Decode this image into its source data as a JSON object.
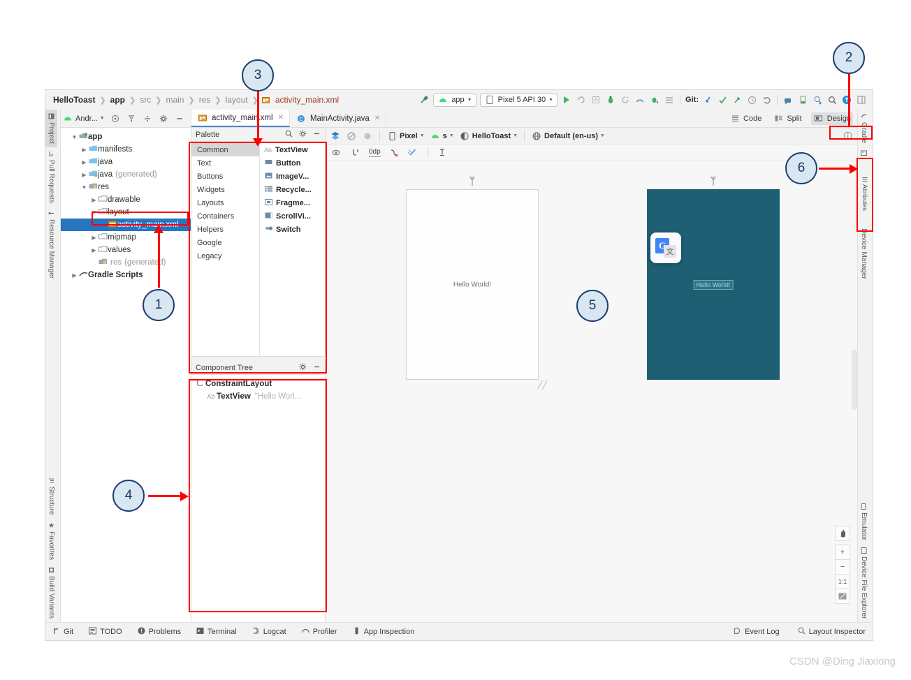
{
  "window": {
    "breadcrumb": [
      "HelloToast",
      "app",
      "src",
      "main",
      "res",
      "layout",
      "activity_main.xml"
    ],
    "run_config": "app",
    "device_target": "Pixel 5 API 30",
    "git_label": "Git:"
  },
  "project_toolbar": {
    "title": "Andr...",
    "icons": [
      "target-icon",
      "collapse-all-icon",
      "split-icon",
      "settings-icon",
      "minimize-icon"
    ]
  },
  "editor_tabs": [
    {
      "label": "activity_main.xml",
      "icon": "xml-layout-icon",
      "active": true,
      "closable": true
    },
    {
      "label": "MainActivity.java",
      "icon": "java-class-icon",
      "active": false,
      "closable": true
    }
  ],
  "view_modes": [
    {
      "label": "Code",
      "icon": "code-icon",
      "selected": false
    },
    {
      "label": "Split",
      "icon": "split-icon",
      "selected": false
    },
    {
      "label": "Design",
      "icon": "design-icon",
      "selected": true
    }
  ],
  "left_rail": {
    "top": [
      {
        "label": "Project",
        "icon": "project-icon",
        "selected": true
      },
      {
        "label": "Pull Requests",
        "icon": "pull-request-icon",
        "selected": false
      },
      {
        "label": "Resource Manager",
        "icon": "resource-icon",
        "selected": false
      }
    ],
    "bottom": [
      {
        "label": "Structure",
        "icon": "structure-icon"
      },
      {
        "label": "Favorites",
        "icon": "star-icon"
      },
      {
        "label": "Build Variants",
        "icon": "build-variants-icon"
      }
    ]
  },
  "right_rail": {
    "top": [
      {
        "label": "Gradle",
        "icon": "gradle-icon"
      },
      {
        "label": "Layout Validation",
        "icon": "layout-validation-icon"
      },
      {
        "label": "Device Manager",
        "icon": "device-manager-icon"
      }
    ],
    "bottom": [
      {
        "label": "Emulator",
        "icon": "emulator-icon"
      },
      {
        "label": "Device File Explorer",
        "icon": "device-file-explorer-icon"
      }
    ],
    "attributes_tab": {
      "label": "Attributes",
      "icon": "attributes-icon"
    }
  },
  "project_tree": [
    {
      "label": "app",
      "indent": 0,
      "arrow": "expanded",
      "icon": "module-icon",
      "bold": true,
      "dim": "",
      "selected": false
    },
    {
      "label": "manifests",
      "indent": 1,
      "arrow": "collapsed",
      "icon": "folder-blue-icon",
      "bold": false,
      "dim": "",
      "selected": false
    },
    {
      "label": "java",
      "indent": 1,
      "arrow": "collapsed",
      "icon": "folder-blue-icon",
      "bold": false,
      "dim": "",
      "selected": false
    },
    {
      "label": "java",
      "indent": 1,
      "arrow": "collapsed",
      "icon": "folder-blue-icon",
      "bold": false,
      "dim": "(generated)",
      "selected": false
    },
    {
      "label": "res",
      "indent": 1,
      "arrow": "expanded",
      "icon": "folder-res-icon",
      "bold": false,
      "dim": "",
      "selected": false
    },
    {
      "label": "drawable",
      "indent": 2,
      "arrow": "collapsed",
      "icon": "folder-gray-icon",
      "bold": false,
      "dim": "",
      "selected": false
    },
    {
      "label": "layout",
      "indent": 2,
      "arrow": "expanded",
      "icon": "folder-gray-icon",
      "bold": false,
      "dim": "",
      "selected": false
    },
    {
      "label": "activity_main.xml",
      "indent": 3,
      "arrow": "none",
      "icon": "xml-layout-icon",
      "bold": false,
      "dim": "",
      "selected": true
    },
    {
      "label": "mipmap",
      "indent": 2,
      "arrow": "collapsed",
      "icon": "folder-gray-icon",
      "bold": false,
      "dim": "",
      "selected": false
    },
    {
      "label": "values",
      "indent": 2,
      "arrow": "collapsed",
      "icon": "folder-gray-icon",
      "bold": false,
      "dim": "",
      "selected": false
    },
    {
      "label": "res",
      "indent": 2,
      "arrow": "none",
      "icon": "folder-res-icon",
      "bold": false,
      "dim": "(generated)",
      "selected": false
    },
    {
      "label": "Gradle Scripts",
      "indent": 0,
      "arrow": "collapsed",
      "icon": "gradle-icon",
      "bold": true,
      "dim": "",
      "selected": false
    }
  ],
  "palette": {
    "title": "Palette",
    "tools": [
      "search-icon",
      "gear-icon",
      "minimize-icon"
    ],
    "categories": [
      {
        "label": "Common",
        "selected": true
      },
      {
        "label": "Text",
        "selected": false
      },
      {
        "label": "Buttons",
        "selected": false
      },
      {
        "label": "Widgets",
        "selected": false
      },
      {
        "label": "Layouts",
        "selected": false
      },
      {
        "label": "Containers",
        "selected": false
      },
      {
        "label": "Helpers",
        "selected": false
      },
      {
        "label": "Google",
        "selected": false
      },
      {
        "label": "Legacy",
        "selected": false
      }
    ],
    "items": [
      {
        "label": "TextView",
        "icon": "ab-text-icon"
      },
      {
        "label": "Button",
        "icon": "button-icon"
      },
      {
        "label": "ImageV...",
        "icon": "image-view-icon"
      },
      {
        "label": "Recycle...",
        "icon": "recycler-view-icon"
      },
      {
        "label": "Fragme...",
        "icon": "fragment-icon"
      },
      {
        "label": "ScrollVi...",
        "icon": "scroll-view-icon"
      },
      {
        "label": "Switch",
        "icon": "switch-icon"
      }
    ]
  },
  "component_tree": {
    "title": "Component Tree",
    "tools": [
      "gear-icon",
      "minimize-icon"
    ],
    "nodes": [
      {
        "icon": "constraint-layout-icon",
        "name": "ConstraintLayout",
        "value": "",
        "indent": 0
      },
      {
        "icon": "ab-text-icon",
        "name": "TextView",
        "value": "\"Hello Worl...",
        "indent": 1
      }
    ]
  },
  "design_toolbar": {
    "row1": {
      "mode_icons": [
        "design-surface-icon",
        "blueprint-icon",
        "both-modes-icon"
      ],
      "menus": [
        {
          "label": "Pixel",
          "icon": "device-icon"
        },
        {
          "label": "s",
          "icon": "api-icon"
        },
        {
          "label": "HelloToast",
          "icon": "theme-icon"
        },
        {
          "label": "Default (en-us)",
          "icon": "locale-icon"
        }
      ]
    },
    "row2": {
      "icons": [
        "view-options-icon",
        "autoconnect-icon",
        "default-margin-0dp",
        "clear-constraints-icon",
        "infer-constraints-icon",
        "baseline-align-icon"
      ],
      "margin_value": "0dp"
    },
    "info_icon": "info-icon"
  },
  "canvas": {
    "devices": [
      {
        "name": "design-preview",
        "label_icon": "pin-icon",
        "text": "Hello World!"
      },
      {
        "name": "blueprint-preview",
        "label_icon": "pin-icon",
        "text": "Hello World!"
      }
    ],
    "zoom_controls": [
      {
        "label": "✋",
        "name": "pan-tool-button"
      },
      {
        "label": "+",
        "name": "zoom-in-button"
      },
      {
        "label": "−",
        "name": "zoom-out-button"
      },
      {
        "label": "1:1",
        "name": "zoom-actual-button"
      },
      {
        "label": "⛶",
        "name": "zoom-fit-button"
      }
    ],
    "overlay_icon": {
      "name": "google-translate-icon",
      "letter": "G",
      "glyph": "文"
    }
  },
  "status_bar": {
    "left": [
      {
        "label": "Git",
        "icon": "git-branch-icon"
      },
      {
        "label": "TODO",
        "icon": "todo-icon"
      },
      {
        "label": "Problems",
        "icon": "problems-icon"
      },
      {
        "label": "Terminal",
        "icon": "terminal-icon"
      },
      {
        "label": "Logcat",
        "icon": "logcat-icon"
      },
      {
        "label": "Profiler",
        "icon": "profiler-icon"
      },
      {
        "label": "App Inspection",
        "icon": "app-inspection-icon"
      }
    ],
    "right": [
      {
        "label": "Event Log",
        "icon": "event-log-icon"
      },
      {
        "label": "Layout Inspector",
        "icon": "layout-inspector-icon"
      }
    ]
  },
  "annotations": {
    "callouts": [
      {
        "number": "1"
      },
      {
        "number": "2"
      },
      {
        "number": "3"
      },
      {
        "number": "4"
      },
      {
        "number": "5"
      },
      {
        "number": "6"
      }
    ],
    "accent_color": "#ff0000",
    "callout_fill": "#d9e7f3",
    "callout_border": "#1d3f6e"
  },
  "watermark": "CSDN @Ding Jiaxiong"
}
